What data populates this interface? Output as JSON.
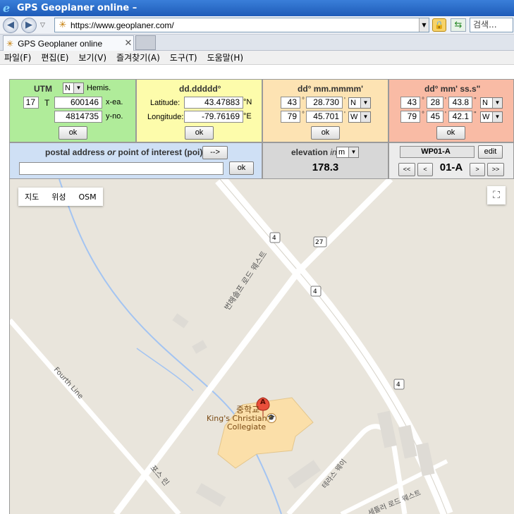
{
  "browser": {
    "title": "GPS Geoplaner online –",
    "url": "https://www.geoplaner.com/",
    "search_placeholder": "검색...",
    "tab_label": "GPS Geoplaner online",
    "menu": [
      "파일(F)",
      "편집(E)",
      "보기(V)",
      "즐겨찾기(A)",
      "도구(T)",
      "도움말(H)"
    ]
  },
  "utm": {
    "header": "UTM",
    "hemis_value": "N",
    "hemis_label": "Hemis.",
    "zone": "17",
    "band": "T",
    "easting": "600146",
    "easting_label": "x-ea.",
    "northing": "4814735",
    "northing_label": "y-no.",
    "ok": "ok"
  },
  "decimal": {
    "header": "dd.ddddd°",
    "lat_label": "Latitude:",
    "lat": "43.47883",
    "lat_hem": "°N",
    "lon_label": "Longitude:",
    "lon": "-79.76169",
    "lon_hem": "°E",
    "ok": "ok"
  },
  "degmin": {
    "header": "dd° mm.mmmm'",
    "lat_deg": "43",
    "lat_min": "28.730",
    "lat_hem": "N",
    "lon_deg": "79",
    "lon_min": "45.701",
    "lon_hem": "W",
    "deg_sym": "°",
    "min_sym": "'",
    "ok": "ok"
  },
  "degminsec": {
    "header": "dd° mm' ss.s\"",
    "lat_deg": "43",
    "lat_min": "28",
    "lat_sec": "43.8",
    "lat_hem": "N",
    "lon_deg": "79",
    "lon_min": "45",
    "lon_sec": "42.1",
    "lon_hem": "W",
    "deg_sym": "°",
    "min_sym": "'",
    "sec_sym": "\"",
    "ok": "ok"
  },
  "poi": {
    "label_a": "postal address",
    "label_or": "or",
    "label_b": "point of interest (poi)",
    "arrow_btn": "-->",
    "input_value": "",
    "ok": "ok"
  },
  "elevation": {
    "label": "elevation",
    "in": "in",
    "unit": "m",
    "value": "178.3"
  },
  "waypoint": {
    "name": "WP01-A",
    "edit": "edit",
    "first": "<<",
    "prev": "<",
    "current": "01-A",
    "next": ">",
    "last": ">>"
  },
  "map": {
    "types": [
      "지도",
      "위성",
      "OSM"
    ],
    "fullscreen_icon": "fullscreen-icon",
    "road_4": "4",
    "road_27": "27",
    "street_vertical": "번해솔프 로드 웨스트",
    "street_fourth": "Fourth Line",
    "street_pos": "포스 린",
    "street_terrace": "테라스 웨이",
    "street_bottom": "세틀러 로드 웨스트",
    "poi_ko": "중학교",
    "poi_en_1": "King's Christian",
    "poi_en_2": "Collegiate",
    "marker_label": "A",
    "colors": {
      "background": "#e9e5dc",
      "road": "#ffffff",
      "building": "#fbdfa9",
      "water": "#a3c4f2"
    }
  }
}
